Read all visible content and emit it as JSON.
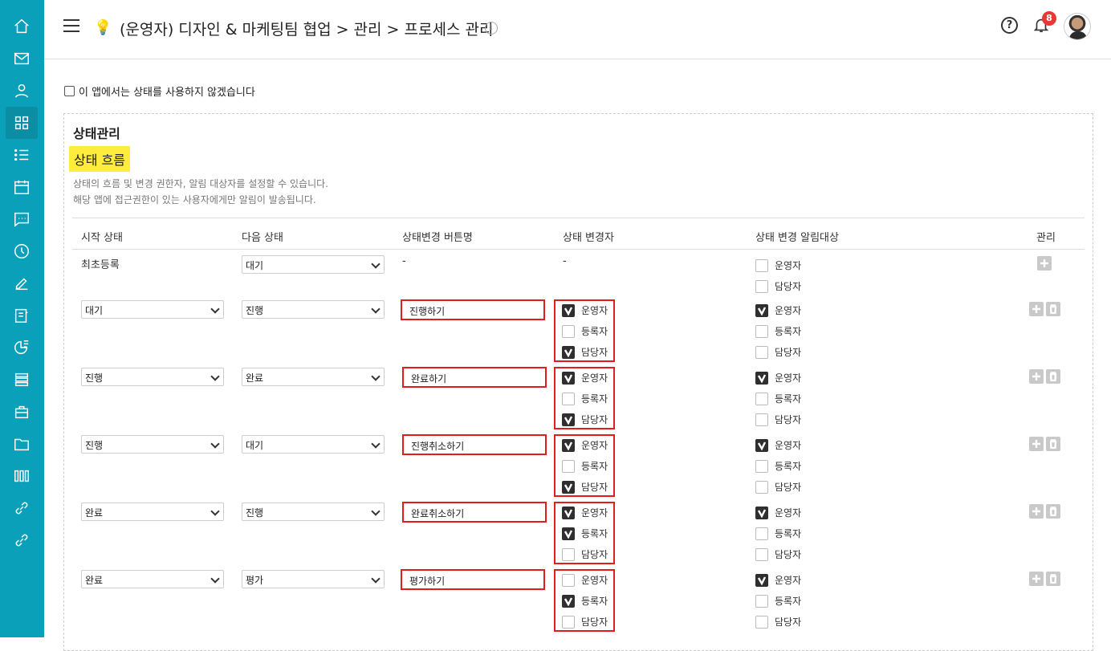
{
  "header": {
    "title": "(운영자) 디자인 & 마케팅팀 협업 > 관리 > 프로세스 관리",
    "notification_count": "8"
  },
  "sidebar": {
    "items": [
      {
        "icon": "home-icon"
      },
      {
        "icon": "mail-icon"
      },
      {
        "icon": "user-icon"
      },
      {
        "icon": "grid-icon",
        "active": true
      },
      {
        "icon": "list-icon"
      },
      {
        "icon": "calendar-icon"
      },
      {
        "icon": "chat-icon"
      },
      {
        "icon": "clock-icon"
      },
      {
        "icon": "edit-icon"
      },
      {
        "icon": "board-icon"
      },
      {
        "icon": "chart-icon"
      },
      {
        "icon": "stack-icon"
      },
      {
        "icon": "briefcase-icon"
      },
      {
        "icon": "folder-icon"
      },
      {
        "icon": "columns-icon"
      },
      {
        "icon": "link-icon"
      },
      {
        "icon": "link2-icon"
      }
    ]
  },
  "disable_status": {
    "label": "이 앱에서는 상태를 사용하지 않겠습니다",
    "checked": false
  },
  "panel": {
    "title": "상태관리",
    "subtitle": "상태 흐름",
    "desc1": "상태의 흐름 및 변경 권한자, 알림 대상자를 설정할 수 있습니다.",
    "desc2": "해당 앱에 접근권한이 있는 사용자에게만 알림이 발송됩니다."
  },
  "table": {
    "headers": {
      "start": "시작 상태",
      "next": "다음 상태",
      "button": "상태변경 버튼명",
      "changer": "상태 변경자",
      "notify": "상태 변경 알림대상",
      "manage": "관리"
    },
    "first_row": {
      "start": "최초등록",
      "next": "대기",
      "button": "-",
      "changer": "-",
      "notify": [
        {
          "label": "운영자",
          "checked": false
        },
        {
          "label": "담당자",
          "checked": false
        }
      ]
    },
    "rows": [
      {
        "start": "대기",
        "next": "진행",
        "button": "진행하기",
        "changer": [
          {
            "label": "운영자",
            "checked": true
          },
          {
            "label": "등록자",
            "checked": false
          },
          {
            "label": "담당자",
            "checked": true
          }
        ],
        "notify": [
          {
            "label": "운영자",
            "checked": true
          },
          {
            "label": "등록자",
            "checked": false
          },
          {
            "label": "담당자",
            "checked": false
          }
        ]
      },
      {
        "start": "진행",
        "next": "완료",
        "button": "완료하기",
        "changer": [
          {
            "label": "운영자",
            "checked": true
          },
          {
            "label": "등록자",
            "checked": false
          },
          {
            "label": "담당자",
            "checked": true
          }
        ],
        "notify": [
          {
            "label": "운영자",
            "checked": true
          },
          {
            "label": "등록자",
            "checked": false
          },
          {
            "label": "담당자",
            "checked": false
          }
        ]
      },
      {
        "start": "진행",
        "next": "대기",
        "button": "진행취소하기",
        "changer": [
          {
            "label": "운영자",
            "checked": true
          },
          {
            "label": "등록자",
            "checked": false
          },
          {
            "label": "담당자",
            "checked": true
          }
        ],
        "notify": [
          {
            "label": "운영자",
            "checked": true
          },
          {
            "label": "등록자",
            "checked": false
          },
          {
            "label": "담당자",
            "checked": false
          }
        ]
      },
      {
        "start": "완료",
        "next": "진행",
        "button": "완료취소하기",
        "changer": [
          {
            "label": "운영자",
            "checked": true
          },
          {
            "label": "등록자",
            "checked": true
          },
          {
            "label": "담당자",
            "checked": false
          }
        ],
        "notify": [
          {
            "label": "운영자",
            "checked": true
          },
          {
            "label": "등록자",
            "checked": false
          },
          {
            "label": "담당자",
            "checked": false
          }
        ]
      },
      {
        "start": "완료",
        "next": "평가",
        "button": "평가하기",
        "changer": [
          {
            "label": "운영자",
            "checked": false
          },
          {
            "label": "등록자",
            "checked": true
          },
          {
            "label": "담당자",
            "checked": false
          }
        ],
        "notify": [
          {
            "label": "운영자",
            "checked": true
          },
          {
            "label": "등록자",
            "checked": false
          },
          {
            "label": "담당자",
            "checked": false
          }
        ]
      }
    ]
  }
}
